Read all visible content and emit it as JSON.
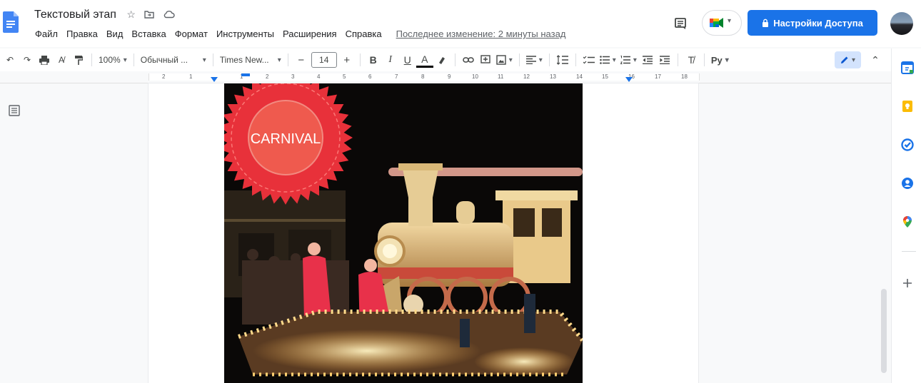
{
  "header": {
    "doc_title": "Текстовый этап",
    "menu": [
      "Файл",
      "Правка",
      "Вид",
      "Вставка",
      "Формат",
      "Инструменты",
      "Расширения",
      "Справка"
    ],
    "last_edit": "Последнее изменение: 2 минуты назад",
    "share_label": "Настройки Доступа"
  },
  "toolbar": {
    "zoom": "100%",
    "style": "Обычный ...",
    "font": "Times New...",
    "font_size": "14",
    "minus": "−",
    "plus": "+",
    "bold": "B",
    "italic": "I",
    "underline": "U",
    "text_color": "A",
    "input_tools": "Pу"
  },
  "ruler": {
    "marks": [
      "2",
      "1",
      "1",
      "2",
      "3",
      "4",
      "5",
      "6",
      "7",
      "8",
      "9",
      "10",
      "11",
      "12",
      "13",
      "14",
      "15",
      "16",
      "17",
      "18"
    ]
  },
  "document": {
    "badge_text": "CARNIVAL"
  },
  "colors": {
    "accent": "#1a73e8",
    "badge_red": "#e8313a",
    "badge_inner": "#ef5a4e"
  },
  "icons": {
    "side_panel": [
      "calendar-icon",
      "keep-icon",
      "tasks-icon",
      "contacts-icon",
      "maps-icon",
      "plus-icon"
    ]
  }
}
